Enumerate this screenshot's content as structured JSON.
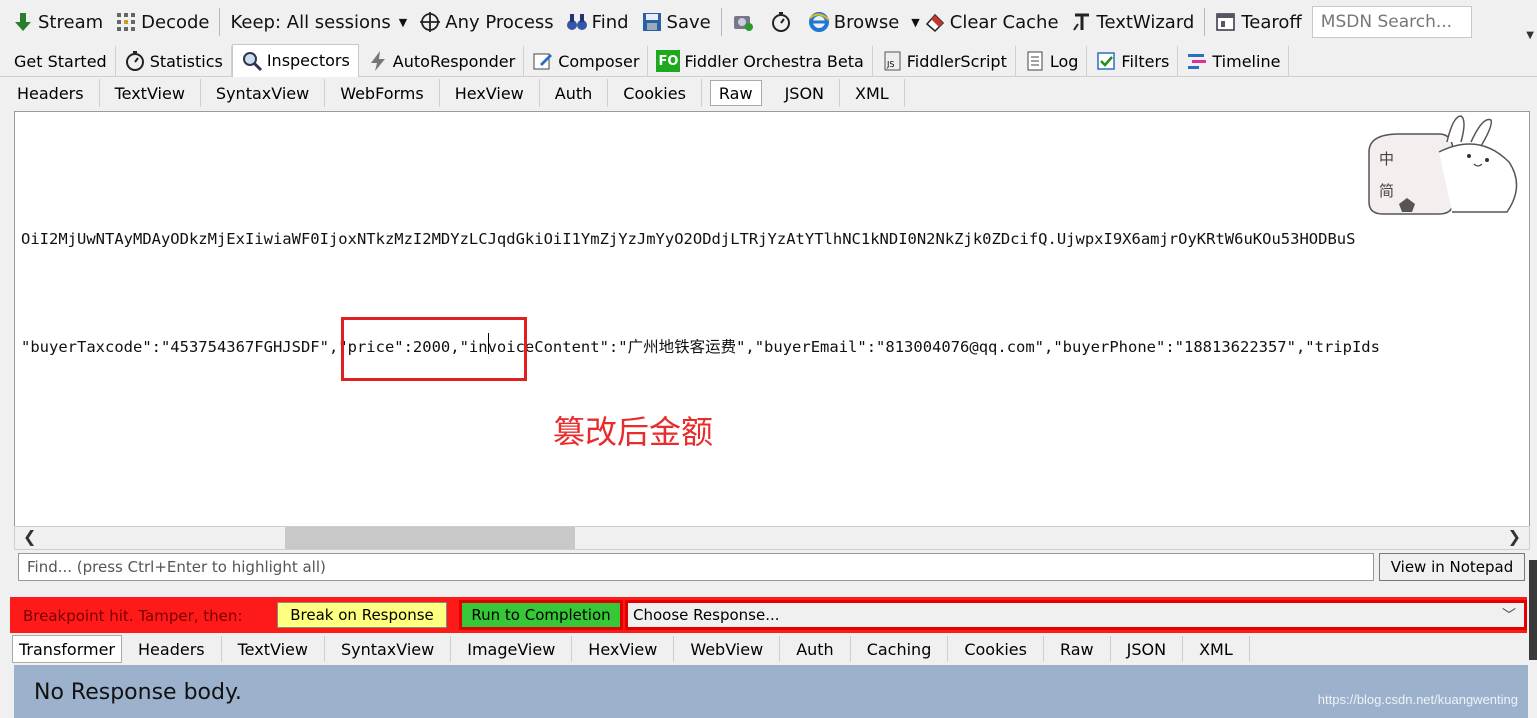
{
  "toolbar": {
    "stream": "Stream",
    "decode": "Decode",
    "keep": "Keep: All sessions",
    "any_process": "Any Process",
    "find": "Find",
    "save": "Save",
    "browse": "Browse",
    "clear_cache": "Clear Cache",
    "textwizard": "TextWizard",
    "tearoff": "Tearoff",
    "search_placeholder": "MSDN Search..."
  },
  "main_tabs": [
    "Get Started",
    "Statistics",
    "Inspectors",
    "AutoResponder",
    "Composer",
    "Fiddler Orchestra Beta",
    "FiddlerScript",
    "Log",
    "Filters",
    "Timeline"
  ],
  "request_tabs": [
    "Headers",
    "TextView",
    "SyntaxView",
    "WebForms",
    "HexView",
    "Auth",
    "Cookies",
    "Raw",
    "JSON",
    "XML"
  ],
  "content": {
    "line1": "OiI2MjUwNTAyMDAyODkzMjExIiwiaWF0IjoxNTkzMzI2MDYzLCJqdGkiOiI1YmZjYzJmYyO2ODdjLTRjYzAtYTlhNC1kNDI0N2NkZjk0ZDcifQ.UjwpxI9X6amjrOyKRtW6uKOu53HODBuS",
    "line2": "\"buyerTaxcode\":\"453754367FGHJSDF\",\"price\":2000,\"invoiceContent\":\"广州地铁客运费\",\"buyerEmail\":\"813004076@qq.com\",\"buyerPhone\":\"18813622357\",\"tripIds",
    "annotation": "篡改后金额",
    "sticker_chars": [
      "中",
      "简"
    ]
  },
  "find_placeholder": "Find... (press Ctrl+Enter to highlight all)",
  "view_notepad": "View in Notepad",
  "breakpoint": {
    "label": "Breakpoint hit. Tamper, then:",
    "break_on_response": "Break on Response",
    "run_to_completion": "Run to Completion",
    "choose_response": "Choose Response..."
  },
  "response_tabs": [
    "Transformer",
    "Headers",
    "TextView",
    "SyntaxView",
    "ImageView",
    "HexView",
    "WebView",
    "Auth",
    "Caching",
    "Cookies",
    "Raw",
    "JSON",
    "XML"
  ],
  "response_body": "No Response body.",
  "watermark": "https://blog.csdn.net/kuangwenting",
  "colors": {
    "breakpoint_red": "#ff1a1a",
    "break_yellow": "#ffff80",
    "run_green": "#36c836",
    "annotation_red": "#e82c2c",
    "response_bg": "#9cb2cc"
  }
}
